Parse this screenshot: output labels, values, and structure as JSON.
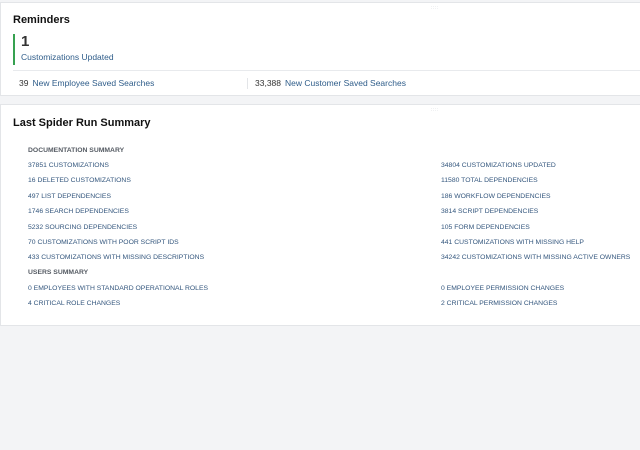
{
  "reminders": {
    "title": "Reminders",
    "kpi": {
      "value": "1",
      "label": "Customizations Updated"
    },
    "stats": [
      {
        "value": "39",
        "label": "New Employee Saved Searches"
      },
      {
        "value": "33,388",
        "label": "New Customer Saved Searches"
      }
    ]
  },
  "summary": {
    "title": "Last Spider Run Summary",
    "documentation_heading": "DOCUMENTATION SUMMARY",
    "documentation_left": [
      "37851 CUSTOMIZATIONS",
      "16 DELETED CUSTOMIZATIONS",
      "497 LIST DEPENDENCIES",
      "1746 SEARCH DEPENDENCIES",
      "5232 SOURCING DEPENDENCIES",
      "70 CUSTOMIZATIONS WITH POOR SCRIPT IDS",
      "433 CUSTOMIZATIONS WITH MISSING DESCRIPTIONS"
    ],
    "documentation_right": [
      "34804 CUSTOMIZATIONS UPDATED",
      "11580 TOTAL DEPENDENCIES",
      "186 WORKFLOW DEPENDENCIES",
      "3814 SCRIPT DEPENDENCIES",
      "105 FORM DEPENDENCIES",
      "441 CUSTOMIZATIONS WITH MISSING HELP",
      "34242 CUSTOMIZATIONS WITH MISSING ACTIVE OWNERS"
    ],
    "users_heading": "USERS SUMMARY",
    "users_left": [
      "0 EMPLOYEES WITH STANDARD OPERATIONAL ROLES",
      "4 CRITICAL ROLE CHANGES"
    ],
    "users_right": [
      "0 EMPLOYEE PERMISSION CHANGES",
      "2 CRITICAL PERMISSION CHANGES"
    ]
  }
}
